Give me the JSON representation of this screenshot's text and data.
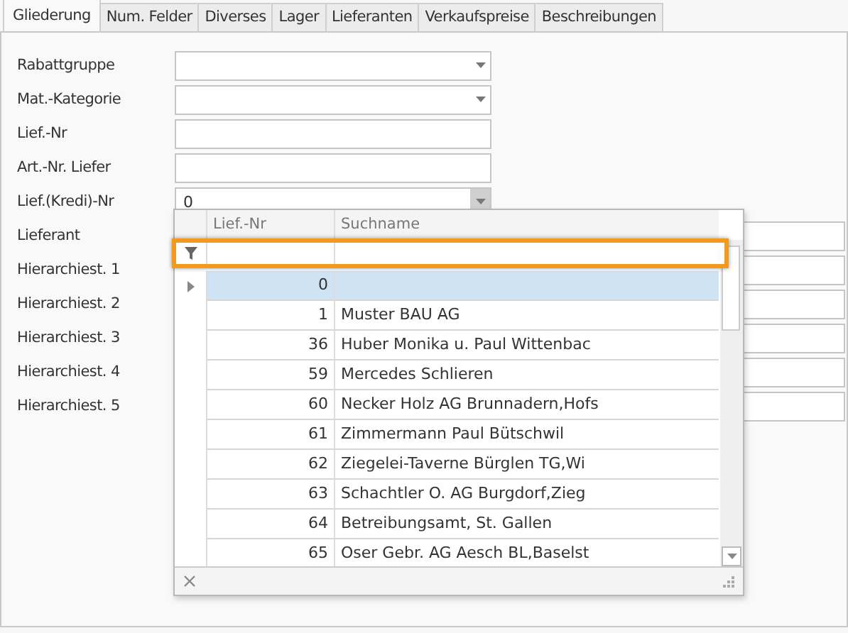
{
  "tabs": [
    {
      "label": "Gliederung",
      "selected": true
    },
    {
      "label": "Num. Felder",
      "selected": false
    },
    {
      "label": "Diverses",
      "selected": false
    },
    {
      "label": "Lager",
      "selected": false
    },
    {
      "label": "Lieferanten",
      "selected": false
    },
    {
      "label": "Verkaufspreise",
      "selected": false
    },
    {
      "label": "Beschreibungen",
      "selected": false
    }
  ],
  "fields": [
    {
      "label": "Rabattgruppe",
      "kind": "combo",
      "expanded": false
    },
    {
      "label": "Mat.-Kategorie",
      "kind": "combo",
      "expanded": false
    },
    {
      "label": "Lief.-Nr",
      "kind": "text"
    },
    {
      "label": "Art.-Nr. Liefer",
      "kind": "text"
    },
    {
      "label": "Lief.(Kredi)-Nr",
      "kind": "combo",
      "value": "0",
      "expanded": true
    },
    {
      "label": "Lieferant",
      "kind": "wide"
    },
    {
      "label": "Hierarchiest. 1",
      "kind": "wide"
    },
    {
      "label": "Hierarchiest. 2",
      "kind": "wide"
    },
    {
      "label": "Hierarchiest. 3",
      "kind": "wide"
    },
    {
      "label": "Hierarchiest. 4",
      "kind": "wide"
    },
    {
      "label": "Hierarchiest. 5",
      "kind": "wide"
    }
  ],
  "dropdown": {
    "columns": [
      "Lief.-Nr",
      "Suchname"
    ],
    "rows": [
      {
        "nr": "0",
        "name": "",
        "selected": true
      },
      {
        "nr": "1",
        "name": "Muster BAU AG",
        "selected": false
      },
      {
        "nr": "36",
        "name": "Huber Monika u. Paul Wittenbac",
        "selected": false
      },
      {
        "nr": "59",
        "name": "Mercedes Schlieren",
        "selected": false
      },
      {
        "nr": "60",
        "name": "Necker Holz AG Brunnadern,Hofs",
        "selected": false
      },
      {
        "nr": "61",
        "name": "Zimmermann Paul Bütschwil",
        "selected": false
      },
      {
        "nr": "62",
        "name": "Ziegelei-Taverne Bürglen TG,Wi",
        "selected": false
      },
      {
        "nr": "63",
        "name": "Schachtler O. AG Burgdorf,Zieg",
        "selected": false
      },
      {
        "nr": "64",
        "name": "Betreibungsamt, St. Gallen",
        "selected": false
      },
      {
        "nr": "65",
        "name": "Oser Gebr. AG Aesch BL,Baselst",
        "selected": false
      }
    ]
  }
}
